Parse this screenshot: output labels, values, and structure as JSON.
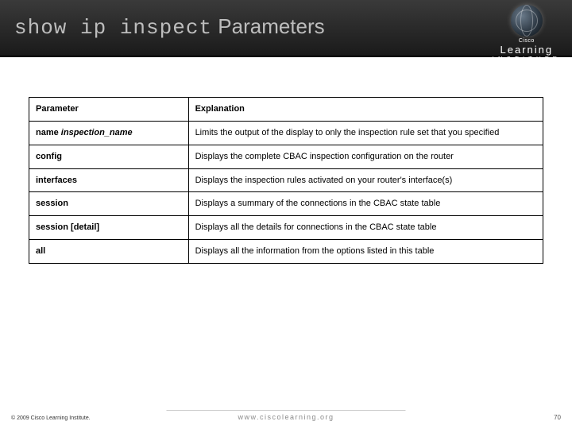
{
  "header": {
    "title_cmd": "show ip inspect",
    "title_suffix": " Parameters",
    "logo_top": "Cisco",
    "logo_mid": "Learning",
    "logo_bot": "INSTITUTE"
  },
  "table": {
    "headers": {
      "param": "Parameter",
      "explanation": "Explanation"
    },
    "rows": [
      {
        "param_prefix": "name ",
        "param_italic": "inspection_name",
        "param_suffix": "",
        "explanation": "Limits the output of the display to only the inspection rule set that you specified"
      },
      {
        "param_prefix": "config",
        "param_italic": "",
        "param_suffix": "",
        "explanation": "Displays the complete CBAC inspection configuration on the router"
      },
      {
        "param_prefix": "interfaces",
        "param_italic": "",
        "param_suffix": "",
        "explanation": "Displays the inspection rules activated on your router's interface(s)"
      },
      {
        "param_prefix": "session",
        "param_italic": "",
        "param_suffix": "",
        "explanation": "Displays a summary of the connections in the CBAC state table"
      },
      {
        "param_prefix": "session ",
        "param_italic": "",
        "param_suffix": "[detail]",
        "explanation": "Displays all the details for connections in the CBAC state table"
      },
      {
        "param_prefix": "all",
        "param_italic": "",
        "param_suffix": "",
        "explanation": "Displays all the information from the options listed in this table"
      }
    ]
  },
  "footer": {
    "copyright": "© 2009 Cisco Learning Institute.",
    "url": "www.ciscolearning.org",
    "page": "70"
  }
}
